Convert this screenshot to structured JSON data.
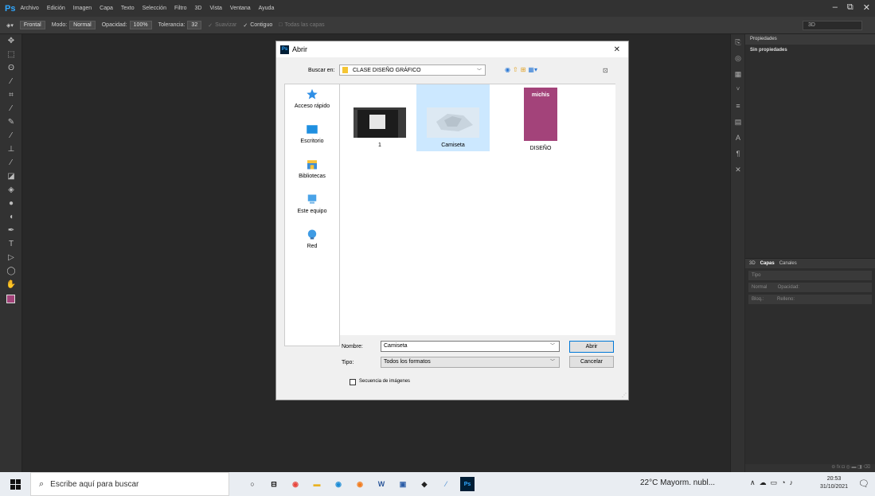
{
  "app": {
    "menu": [
      "Archivo",
      "Edición",
      "Imagen",
      "Capa",
      "Texto",
      "Selección",
      "Filtro",
      "3D",
      "Vista",
      "Ventana",
      "Ayuda"
    ],
    "window_controls": [
      "–",
      "⧉",
      "✕"
    ]
  },
  "options_bar": {
    "sample_label": "Frontal",
    "mode_label": "Modo:",
    "mode_value": "Normal",
    "opacity_label": "Opacidad:",
    "opacity_value": "100%",
    "tolerance_label": "Tolerancia:",
    "tolerance_value": "32",
    "smooth_label": "Suavizar",
    "contiguous_label": "Contiguo",
    "all_layers_label": "Todas las capas",
    "workspace": "3D"
  },
  "panels": {
    "properties_tab": "Propiedades",
    "properties_empty": "Sin propiedades",
    "layers_tabs": [
      "3D",
      "Capas",
      "Canales"
    ],
    "layers_filter": "Tipo",
    "layers_blend": "Normal",
    "layers_opacity_label": "Opacidad:",
    "layers_lock_label": "Bloq.:",
    "layers_fill_label": "Relleno:"
  },
  "dialog": {
    "title": "Abrir",
    "look_in_label": "Buscar en:",
    "look_in_value": "CLASE DISEÑO GRÁFICO",
    "places": [
      {
        "label": "Acceso rápido",
        "icon": "star-icon"
      },
      {
        "label": "Escritorio",
        "icon": "desktop-icon"
      },
      {
        "label": "Bibliotecas",
        "icon": "libraries-icon"
      },
      {
        "label": "Este equipo",
        "icon": "computer-icon"
      },
      {
        "label": "Red",
        "icon": "network-icon"
      }
    ],
    "files": [
      {
        "name": "1",
        "selected": false
      },
      {
        "name": "Camiseta",
        "selected": true
      },
      {
        "name": "DISEÑO",
        "selected": false,
        "thumb_text": "michis"
      }
    ],
    "file_name_label": "Nombre:",
    "file_name_value": "Camiseta",
    "file_type_label": "Tipo:",
    "file_type_value": "Todos los formatos",
    "open_button": "Abrir",
    "cancel_button": "Cancelar",
    "sequence_label": "Secuencia de imágenes"
  },
  "taskbar": {
    "search_placeholder": "Escribe aquí para buscar",
    "weather": "22°C  Mayorm. nubl...",
    "time": "20:53",
    "date": "31/10/2021"
  },
  "colors": {
    "foreground": "#a3437a",
    "accent": "#0078d7",
    "selection": "#cce8ff"
  }
}
